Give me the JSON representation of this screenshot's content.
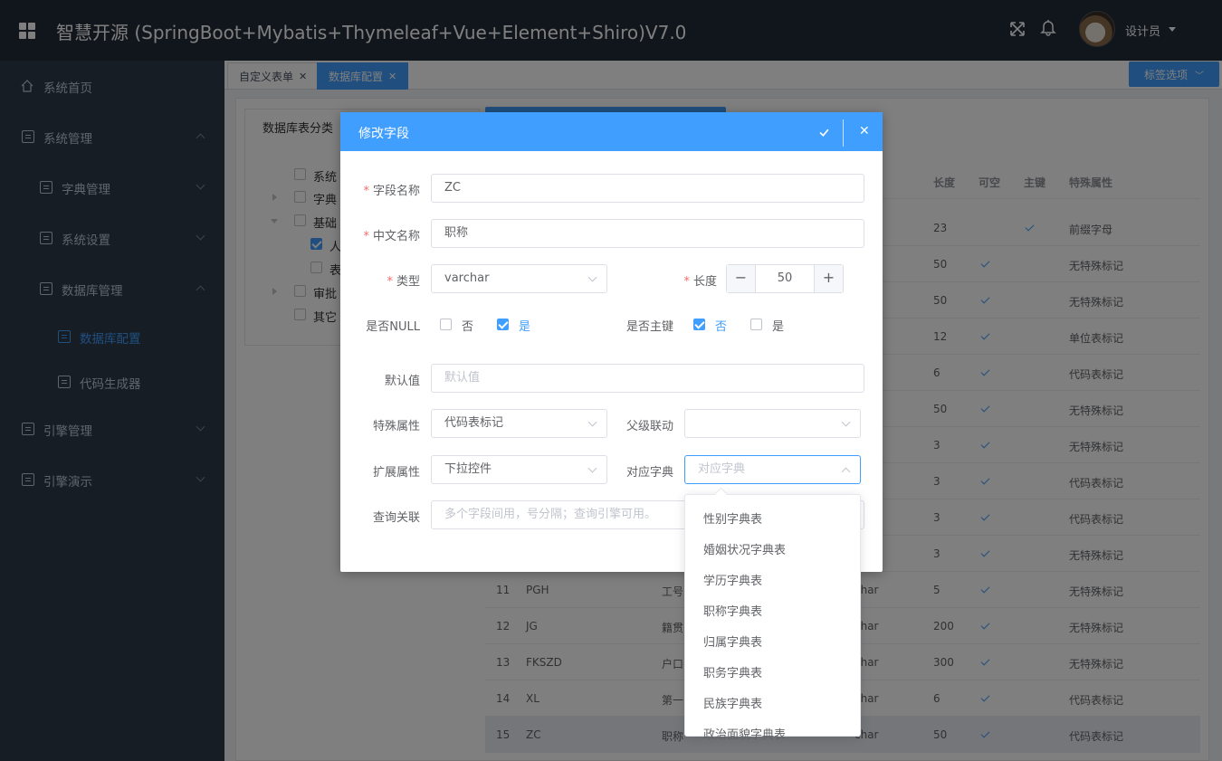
{
  "header": {
    "title": "智慧开源 (SpringBoot+Mybatis+Thymeleaf+Vue+Element+Shiro)V7.0",
    "user": "设计员"
  },
  "sidebar": {
    "items": [
      "系统首页",
      "系统管理",
      "字典管理",
      "系统设置",
      "数据库管理",
      "数据库配置",
      "代码生成器",
      "引擎管理",
      "引擎演示"
    ]
  },
  "tabs": [
    {
      "label": "自定义表单"
    },
    {
      "label": "数据库配置"
    }
  ],
  "tab_options": "标签选项",
  "tree": {
    "title": "数据库表分类",
    "nodes": [
      "系统",
      "字典",
      "基础",
      "人",
      "表",
      "审批",
      "其它"
    ]
  },
  "table": {
    "headers": {
      "len": "长度",
      "nullable": "可空",
      "pk": "主键",
      "special": "特殊属性"
    },
    "rows": [
      {
        "no": "",
        "name": "",
        "cn": "",
        "type": "",
        "len": "23",
        "nullable": false,
        "pk": true,
        "special": "前缀字母"
      },
      {
        "no": "",
        "name": "",
        "cn": "",
        "type": "",
        "len": "50",
        "nullable": true,
        "pk": false,
        "special": "无特殊标记"
      },
      {
        "no": "",
        "name": "",
        "cn": "",
        "type": "",
        "len": "50",
        "nullable": true,
        "pk": false,
        "special": "无特殊标记"
      },
      {
        "no": "",
        "name": "",
        "cn": "",
        "type": "",
        "len": "12",
        "nullable": true,
        "pk": false,
        "special": "单位表标记"
      },
      {
        "no": "",
        "name": "",
        "cn": "",
        "type": "",
        "len": "6",
        "nullable": true,
        "pk": false,
        "special": "代码表标记"
      },
      {
        "no": "",
        "name": "",
        "cn": "",
        "type": "",
        "len": "50",
        "nullable": true,
        "pk": false,
        "special": "无特殊标记"
      },
      {
        "no": "",
        "name": "",
        "cn": "",
        "type": "",
        "len": "3",
        "nullable": true,
        "pk": false,
        "special": "无特殊标记"
      },
      {
        "no": "",
        "name": "",
        "cn": "",
        "type": "",
        "len": "3",
        "nullable": true,
        "pk": false,
        "special": "代码表标记"
      },
      {
        "no": "",
        "name": "",
        "cn": "",
        "type": "",
        "len": "3",
        "nullable": true,
        "pk": false,
        "special": "代码表标记"
      },
      {
        "no": "",
        "name": "",
        "cn": "",
        "type": "",
        "len": "3",
        "nullable": true,
        "pk": false,
        "special": "无特殊标记"
      },
      {
        "no": "11",
        "name": "PGH",
        "cn": "工号",
        "type": "char",
        "len": "5",
        "nullable": true,
        "pk": false,
        "special": "无特殊标记"
      },
      {
        "no": "12",
        "name": "JG",
        "cn": "籍贯",
        "type": "char",
        "len": "200",
        "nullable": true,
        "pk": false,
        "special": "无特殊标记"
      },
      {
        "no": "13",
        "name": "FKSZD",
        "cn": "户口",
        "type": "char",
        "len": "300",
        "nullable": true,
        "pk": false,
        "special": "无特殊标记"
      },
      {
        "no": "14",
        "name": "XL",
        "cn": "第一",
        "type": "char",
        "len": "6",
        "nullable": true,
        "pk": false,
        "special": "代码表标记"
      },
      {
        "no": "15",
        "name": "ZC",
        "cn": "职称",
        "type": "char",
        "len": "50",
        "nullable": true,
        "pk": false,
        "special": "代码表标记"
      }
    ]
  },
  "dialog": {
    "title": "修改字段",
    "field_name_label": "字段名称",
    "field_name": "ZC",
    "cn_name_label": "中文名称",
    "cn_name": "职称",
    "type_label": "类型",
    "type": "varchar",
    "length_label": "长度",
    "length": "50",
    "minus": "−",
    "plus": "+",
    "null_label": "是否NULL",
    "no": "否",
    "yes": "是",
    "pk_label": "是否主键",
    "default_label": "默认值",
    "default_placeholder": "默认值",
    "special_label": "特殊属性",
    "special": "代码表标记",
    "parent_label": "父级联动",
    "parent": "",
    "ext_label": "扩展属性",
    "ext": "下拉控件",
    "dict_label": "对应字典",
    "dict_placeholder": "对应字典",
    "query_label": "查询关联",
    "query_placeholder": "多个字段间用，号分隔；查询引擎可用。"
  },
  "dropdown": {
    "options": [
      "性别字典表",
      "婚姻状况字典表",
      "学历字典表",
      "职称字典表",
      "归属字典表",
      "职务字典表",
      "民族字典表",
      "政治面貌字典表"
    ]
  }
}
